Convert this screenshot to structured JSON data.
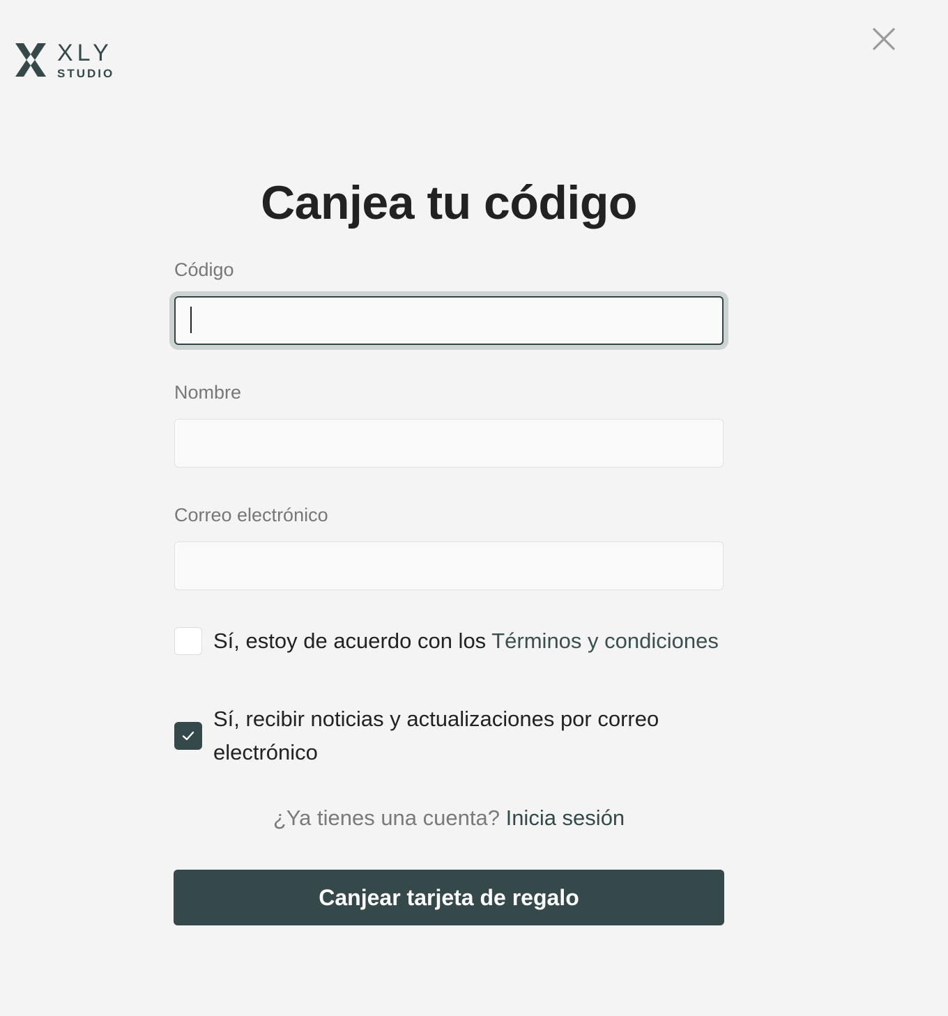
{
  "logo": {
    "main": "XLY",
    "sub": "STUDIO"
  },
  "close_icon": "close-icon",
  "title": "Canjea tu código",
  "form": {
    "code": {
      "label": "Código",
      "value": "",
      "placeholder": ""
    },
    "name": {
      "label": "Nombre",
      "value": "",
      "placeholder": ""
    },
    "email": {
      "label": "Correo electrónico",
      "value": "",
      "placeholder": ""
    }
  },
  "terms": {
    "checked": false,
    "text": "Sí, estoy de acuerdo con los ",
    "link": "Términos y condiciones"
  },
  "newsletter": {
    "checked": true,
    "text": "Sí, recibir noticias y actualizaciones por correo electrónico"
  },
  "login": {
    "prompt": "¿Ya tienes una cuenta? ",
    "link": "Inicia sesión"
  },
  "submit_label": "Canjear tarjeta de regalo",
  "colors": {
    "background": "#f4f4f4",
    "accent": "#35494a",
    "text": "#222222",
    "muted": "#777777"
  }
}
